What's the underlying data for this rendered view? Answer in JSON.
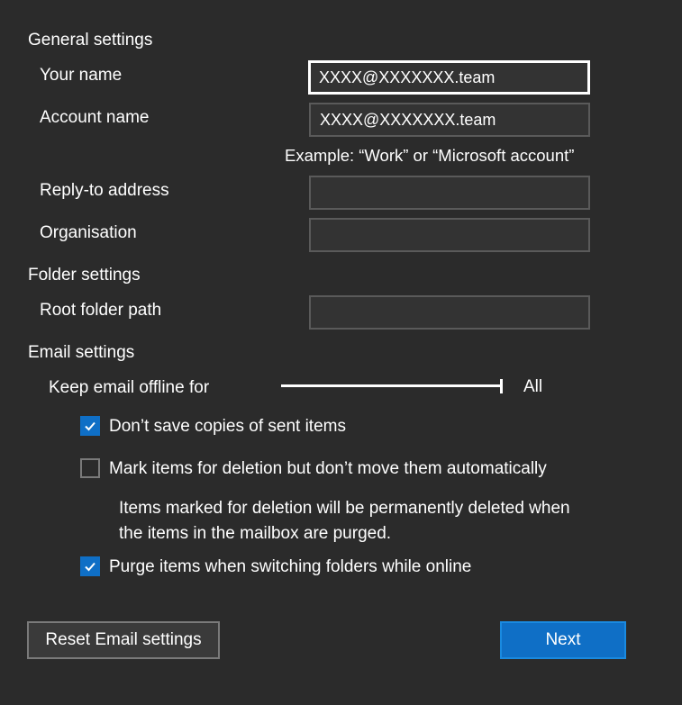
{
  "general": {
    "title": "General settings",
    "your_name_label": "Your name",
    "your_name_value": "XXXX@XXXXXXX.team",
    "account_name_label": "Account name",
    "account_name_value": "XXXX@XXXXXXX.team",
    "account_name_hint": "Example: “Work” or “Microsoft account”",
    "reply_to_label": "Reply-to address",
    "reply_to_value": "",
    "organisation_label": "Organisation",
    "organisation_value": ""
  },
  "folder": {
    "title": "Folder settings",
    "root_path_label": "Root folder path",
    "root_path_value": ""
  },
  "email": {
    "title": "Email settings",
    "offline_label": "Keep email offline for",
    "offline_value": "All",
    "offline_level": 1.0,
    "no_sent_copies_label": "Don’t save copies of sent items",
    "no_sent_copies_checked": true,
    "mark_deletion_label": "Mark items for deletion but don’t move them automatically",
    "mark_deletion_checked": false,
    "mark_deletion_note_1": "Items marked for deletion will be permanently deleted when",
    "mark_deletion_note_2": "the items in the mailbox are purged.",
    "purge_label": "Purge items when switching folders while online",
    "purge_checked": true
  },
  "buttons": {
    "reset": "Reset Email settings",
    "next": "Next"
  },
  "colors": {
    "background": "#2b2b2b",
    "accent": "#0f6fc6",
    "field_bg": "#333333"
  }
}
